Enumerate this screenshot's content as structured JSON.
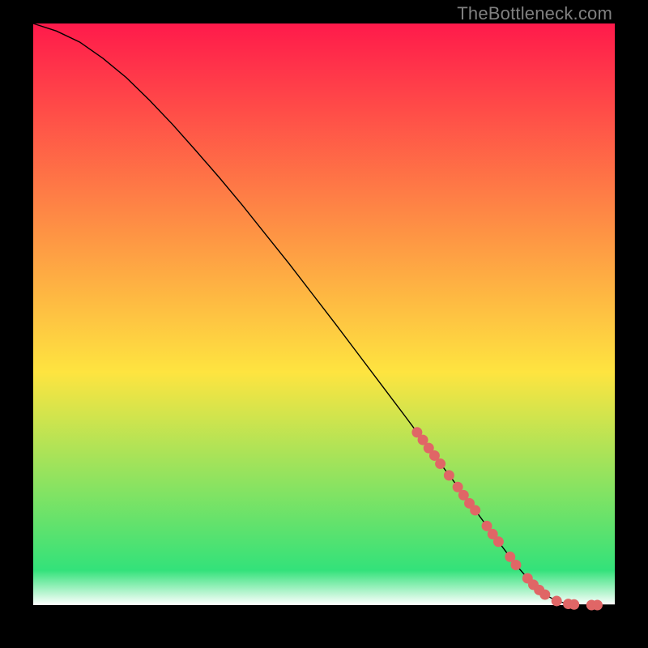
{
  "watermark": "TheBottleneck.com",
  "colors": {
    "marker_fill": "#e06666",
    "marker_stroke": "#e06666",
    "line_stroke": "#000000",
    "grad_top": "#ff1a4b",
    "grad_mid": "#fee440",
    "grad_low": "#33e27a",
    "grad_bottom": "#ffffff"
  },
  "chart_data": {
    "type": "line",
    "title": "",
    "xlabel": "",
    "ylabel": "",
    "xlim": [
      0,
      100
    ],
    "ylim": [
      0,
      100
    ],
    "legend": false,
    "grid": false,
    "series": [
      {
        "name": "curve",
        "x": [
          0,
          4,
          8,
          12,
          16,
          20,
          24,
          28,
          32,
          36,
          40,
          44,
          48,
          52,
          56,
          60,
          64,
          68,
          72,
          76,
          80,
          83,
          86,
          88,
          90,
          92,
          94,
          96,
          98,
          100
        ],
        "y": [
          100,
          98.7,
          96.8,
          94.0,
          90.7,
          86.8,
          82.6,
          78.1,
          73.5,
          68.7,
          63.7,
          58.7,
          53.5,
          48.3,
          43.0,
          37.7,
          32.4,
          27.0,
          21.7,
          16.3,
          10.9,
          6.9,
          3.5,
          1.8,
          0.7,
          0.2,
          0.05,
          0.0,
          0.0,
          0.0
        ]
      },
      {
        "name": "markers",
        "x": [
          66,
          67,
          68,
          69,
          70,
          71.5,
          73,
          74,
          75,
          76,
          78,
          79,
          80,
          82,
          83,
          85,
          86,
          87,
          88,
          90,
          92,
          93,
          96,
          97
        ],
        "y": [
          29.7,
          28.4,
          27.0,
          25.7,
          24.3,
          22.3,
          20.3,
          18.9,
          17.5,
          16.3,
          13.6,
          12.2,
          10.9,
          8.3,
          6.9,
          4.6,
          3.5,
          2.6,
          1.8,
          0.7,
          0.2,
          0.1,
          0.0,
          0.0
        ]
      }
    ]
  }
}
